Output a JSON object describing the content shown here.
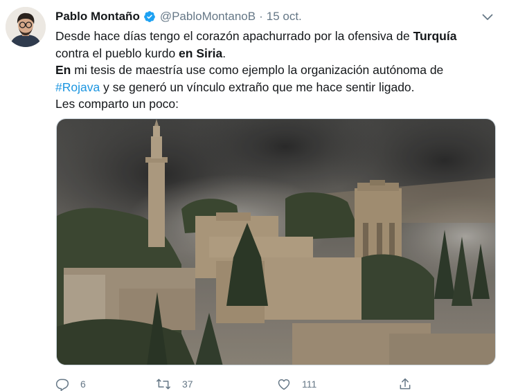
{
  "tweet": {
    "author_name": "Pablo Montaño",
    "handle": "@PabloMontanoB",
    "separator": "·",
    "date": "15 oct.",
    "lines": [
      {
        "pre": "Desde hace días tengo el corazón apachurrado por la ofensiva de ",
        "bold": "Turquía"
      },
      {
        "pre": "contra el pueblo kurdo ",
        "bold": "en Siria",
        "post": "."
      },
      {
        "bold": "En",
        "pre": " mi tesis de maestría use como ejemplo la organización autónoma de"
      },
      {
        "hashtag": "#Rojava",
        "post": " y se generó un vínculo extraño que me hace sentir ligado."
      },
      {
        "pre": "Les comparto un poco:"
      }
    ]
  },
  "actions": {
    "reply_count": "6",
    "retweet_count": "37",
    "like_count": "111"
  },
  "colors": {
    "verified": "#1da1f2",
    "hashtag": "#1b95e0",
    "muted": "#657786"
  },
  "icons": [
    "verified-badge-icon",
    "chevron-down-icon",
    "reply-icon",
    "retweet-icon",
    "like-icon",
    "share-icon"
  ]
}
